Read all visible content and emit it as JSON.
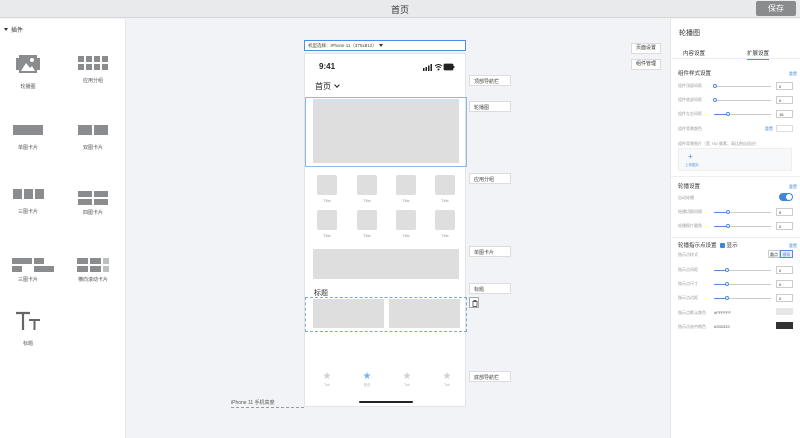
{
  "topbar": {
    "title": "首页",
    "save_label": "保存"
  },
  "left_panel": {
    "section": "插件",
    "components": [
      {
        "label": "轮播图",
        "icon": "image-icon"
      },
      {
        "label": "应用分组",
        "icon": "grid-icon"
      },
      {
        "label": "单图卡片",
        "icon": "single-card-icon"
      },
      {
        "label": "双图卡片",
        "icon": "double-card-icon"
      },
      {
        "label": "三图卡片",
        "icon": "triple-card-icon"
      },
      {
        "label": "四图卡片",
        "icon": "quad-card-icon"
      },
      {
        "label": "三图卡片",
        "icon": "triple-card-2-icon"
      },
      {
        "label": "横向滚动卡片",
        "icon": "scroll-card-icon"
      },
      {
        "label": "标题",
        "icon": "title-text-icon"
      }
    ]
  },
  "canvas": {
    "device_select": "机型选择：iPhone 11（375x812）",
    "status_time": "9:41",
    "home_title": "首页",
    "app_labels": [
      "Title",
      "Title",
      "Title",
      "Title",
      "Title",
      "Title",
      "Title",
      "Title"
    ],
    "section_title": "标题",
    "tabs": [
      "Tab",
      "首页",
      "Tab",
      "Tab"
    ],
    "tags": {
      "nav": "顶部导航栏",
      "banner": "轮播图",
      "apps": "应用分组",
      "single": "单图卡片",
      "title": "标题",
      "tabbar": "底部导航栏"
    },
    "page_settings": "页面设置",
    "component_mgmt": "组件管理",
    "device_model": "iPhone 11 手机高度"
  },
  "right_panel": {
    "title": "轮播图",
    "tabs": [
      "内容设置",
      "扩展设置"
    ],
    "group1": {
      "title": "组件样式设置",
      "reset": "重置",
      "rows": [
        {
          "label": "组件顶部间距",
          "value": "0"
        },
        {
          "label": "组件底部间距",
          "value": "0"
        },
        {
          "label": "组件左右间距",
          "value": "16"
        }
      ],
      "bg_color_label": "组件背景颜色",
      "bg_color_reset": "重置",
      "bg_image_label": "组件背景图片（宽 750 像素，高比例自适应）",
      "upload_label": "上传图片"
    },
    "group2": {
      "title": "轮播设置",
      "reset": "重置",
      "autoplay_label": "自动轮播",
      "rows": [
        {
          "label": "轮播切换间隔",
          "value": "5"
        },
        {
          "label": "轮播图片圆角",
          "value": "0"
        }
      ]
    },
    "group3": {
      "title": "轮播指示点设置",
      "show_label": "显示",
      "reset": "重置",
      "style_label": "指示点样式",
      "styles": [
        "圆点",
        "横条"
      ],
      "rows": [
        {
          "label": "指示点间距",
          "value": "0"
        },
        {
          "label": "指示点尺寸",
          "value": "0"
        },
        {
          "label": "指示点边距",
          "value": "0"
        }
      ],
      "color_default_label": "指示点默认颜色",
      "color_default_value": "#FFFFFF",
      "color_active_label": "指示点选中颜色",
      "color_active_value": "#333333"
    }
  },
  "colors": {
    "accent": "#3c86de",
    "placeholder": "#dedede"
  }
}
